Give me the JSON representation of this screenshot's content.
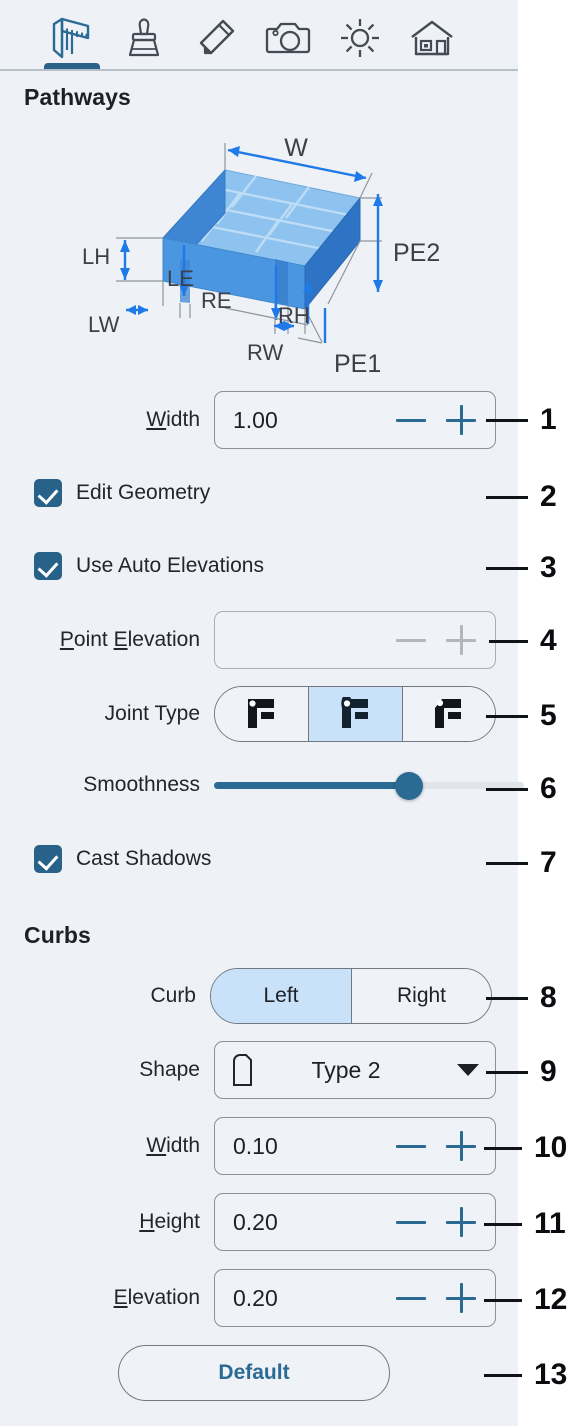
{
  "toolbar": {
    "tabs": [
      {
        "icon": "caliper-ruler-icon",
        "name": "terrain-tools-tab",
        "active": true
      },
      {
        "icon": "paint-brush-icon",
        "name": "paint-tab",
        "active": false
      },
      {
        "icon": "pencil-icon",
        "name": "draw-tab",
        "active": false
      },
      {
        "icon": "camera-icon",
        "name": "camera-tab",
        "active": false
      },
      {
        "icon": "sun-icon",
        "name": "lighting-tab",
        "active": false
      },
      {
        "icon": "house-icon",
        "name": "building-tab",
        "active": false
      }
    ]
  },
  "sections": {
    "pathways_title": "Pathways",
    "curbs_title": "Curbs"
  },
  "diagram": {
    "name": "pathway-dimensions-diagram",
    "labels": {
      "w": "W",
      "pe2": "PE2",
      "pe1": "PE1",
      "lh": "LH",
      "lw": "LW",
      "le": "LE",
      "re": "RE",
      "rh": "RH",
      "rw": "RW"
    },
    "colors": {
      "top_face": "#8ec2ef",
      "front_face": "#4a96e0",
      "left_face": "#3e86d4",
      "right_face": "#2f73c4",
      "dimension_arrow": "#1f7ae8",
      "leader": "#7b8590"
    }
  },
  "pathways": {
    "width_label": "Width",
    "width_accel": "W",
    "width_value": "1.00",
    "edit_geometry_label": "Edit Geometry",
    "edit_geometry_checked": true,
    "use_auto_elevations_label": "Use Auto Elevations",
    "use_auto_elevations_checked": true,
    "point_elevation_label_a": "P",
    "point_elevation_label_b": "oint ",
    "point_elevation_label_c": "E",
    "point_elevation_label_d": "levation",
    "point_elevation_value": "",
    "point_elevation_disabled": true,
    "joint_type_label": "Joint Type",
    "joint_types": [
      {
        "name": "joint-type-miter",
        "selected": false
      },
      {
        "name": "joint-type-round",
        "selected": true
      },
      {
        "name": "joint-type-bevel",
        "selected": false
      }
    ],
    "smoothness_label": "Smoothness",
    "smoothness_percent": 63,
    "cast_shadows_label": "Cast Shadows",
    "cast_shadows_checked": true
  },
  "curbs": {
    "curb_label": "Curb",
    "side_options": [
      {
        "label": "Left",
        "selected": true
      },
      {
        "label": "Right",
        "selected": false
      }
    ],
    "shape_label": "Shape",
    "shape_value": "Type 2",
    "width_label": "Width",
    "width_value": "0.10",
    "height_label": "Height",
    "height_value": "0.20",
    "elevation_label": "Elevation",
    "elevation_value": "0.20",
    "default_button_label": "Default"
  },
  "callouts": [
    {
      "n": "1",
      "target": "pathways-width-spinbox"
    },
    {
      "n": "2",
      "target": "edit-geometry-checkbox"
    },
    {
      "n": "3",
      "target": "use-auto-elevations-checkbox"
    },
    {
      "n": "4",
      "target": "point-elevation-spinbox"
    },
    {
      "n": "5",
      "target": "joint-type-segmented"
    },
    {
      "n": "6",
      "target": "smoothness-slider"
    },
    {
      "n": "7",
      "target": "cast-shadows-checkbox"
    },
    {
      "n": "8",
      "target": "curb-side-segmented"
    },
    {
      "n": "9",
      "target": "curb-shape-dropdown"
    },
    {
      "n": "10",
      "target": "curb-width-spinbox"
    },
    {
      "n": "11",
      "target": "curb-height-spinbox"
    },
    {
      "n": "12",
      "target": "curb-elevation-spinbox"
    },
    {
      "n": "13",
      "target": "curb-default-button"
    }
  ],
  "theme": {
    "panel_bg": "#eef1f6",
    "accent_blue": "#2a6a93",
    "checkbox_blue": "#286288",
    "selected_blue": "#c9e2fa",
    "border_gray": "#8b9099",
    "text_dark": "#1d2127"
  }
}
